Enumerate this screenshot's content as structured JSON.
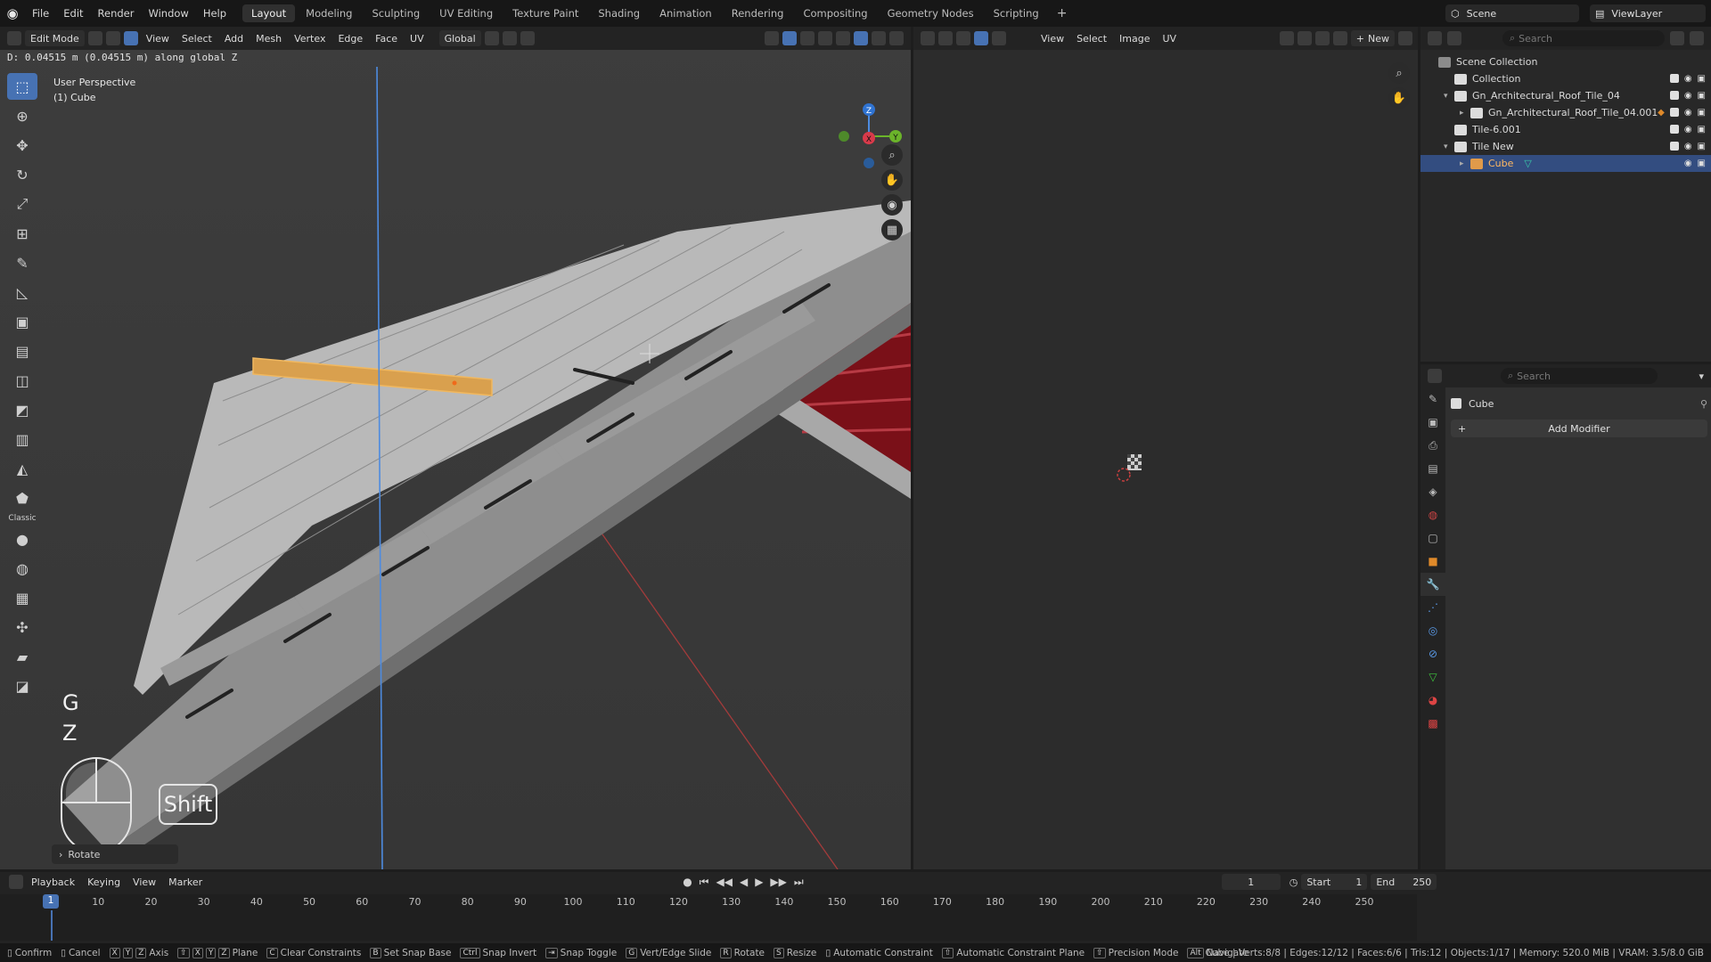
{
  "menu": [
    "File",
    "Edit",
    "Render",
    "Window",
    "Help"
  ],
  "workspaces": [
    {
      "label": "Layout",
      "active": true
    },
    {
      "label": "Modeling"
    },
    {
      "label": "Sculpting"
    },
    {
      "label": "UV Editing"
    },
    {
      "label": "Texture Paint"
    },
    {
      "label": "Shading"
    },
    {
      "label": "Animation"
    },
    {
      "label": "Rendering"
    },
    {
      "label": "Compositing"
    },
    {
      "label": "Geometry Nodes"
    },
    {
      "label": "Scripting"
    }
  ],
  "scene": {
    "name": "Scene",
    "view_layer": "ViewLayer"
  },
  "viewport": {
    "mode": "Edit Mode",
    "menus": [
      "View",
      "Select",
      "Add",
      "Mesh",
      "Vertex",
      "Edge",
      "Face",
      "UV"
    ],
    "orientation": "Global",
    "status_message": "D: 0.04515 m (0.04515 m) along global Z",
    "perspective": "User Perspective",
    "object": "(1) Cube",
    "keys": [
      "G",
      "Z"
    ],
    "shift_key": "Shift",
    "redo_panel": "Rotate",
    "toolbar_classic_label": "Classic"
  },
  "uv_editor": {
    "menus": [
      "View",
      "Select",
      "Image",
      "UV"
    ],
    "new_button": "New"
  },
  "outliner": {
    "search_placeholder": "Search",
    "rows": [
      {
        "label": "Scene Collection",
        "indent": 0
      },
      {
        "label": "Collection",
        "indent": 1
      },
      {
        "label": "Gn_Architectural_Roof_Tile_04",
        "indent": 1
      },
      {
        "label": "Gn_Architectural_Roof_Tile_04.001",
        "indent": 2
      },
      {
        "label": "Tile-6.001",
        "indent": 1
      },
      {
        "label": "Tile New",
        "indent": 1
      },
      {
        "label": "Cube",
        "indent": 2,
        "selected": true
      }
    ]
  },
  "properties": {
    "search_placeholder": "Search",
    "object_name": "Cube",
    "add_modifier": "Add Modifier"
  },
  "timeline": {
    "menus": [
      "Playback",
      "Keying",
      "View",
      "Marker"
    ],
    "current_frame": "1",
    "start_label": "Start",
    "start_value": "1",
    "end_label": "End",
    "end_value": "250",
    "ruler": [
      "1",
      "10",
      "20",
      "30",
      "40",
      "50",
      "60",
      "70",
      "80",
      "90",
      "100",
      "110",
      "120",
      "130",
      "140",
      "150",
      "160",
      "170",
      "180",
      "190",
      "200",
      "210",
      "220",
      "230",
      "240",
      "250"
    ]
  },
  "statusbar": {
    "items": [
      "Confirm",
      "Cancel",
      "Axis",
      "Plane",
      "Clear Constraints",
      "Set Snap Base",
      "Snap Invert",
      "Snap Toggle",
      "Vert/Edge Slide",
      "Rotate",
      "Resize",
      "Automatic Constraint",
      "Automatic Constraint Plane",
      "Precision Mode",
      "Navigate"
    ],
    "stats": "Cube | Verts:8/8 | Edges:12/12 | Faces:6/6 | Tris:12 | Objects:1/17 | Memory: 520.0 MiB | VRAM: 3.5/8.0 GiB"
  },
  "colors": {
    "accent": "#4772b3",
    "selected_edge": "#e8a94f",
    "header": "#232323"
  }
}
